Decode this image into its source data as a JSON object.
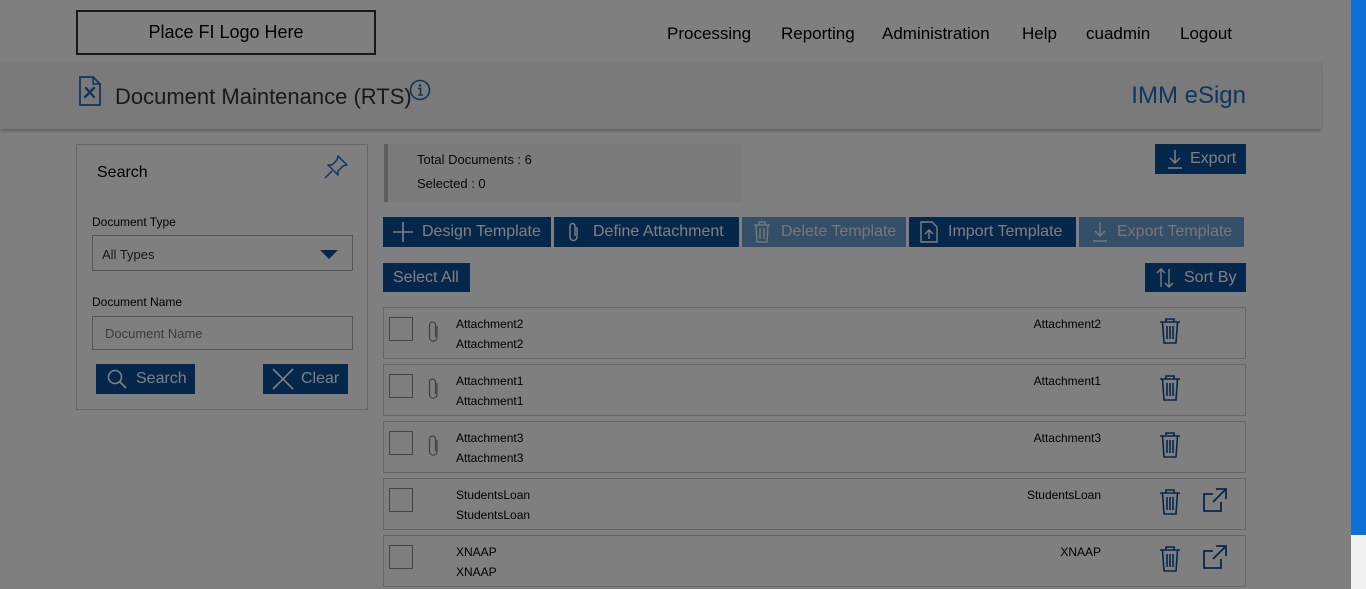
{
  "nav": {
    "logo_text": "Place FI Logo Here",
    "items": [
      "Processing",
      "Reporting",
      "Administration",
      "Help",
      "cuadmin",
      "Logout"
    ]
  },
  "header": {
    "title": "Document Maintenance (RTS)",
    "brand": "IMM eSign"
  },
  "search": {
    "heading": "Search",
    "doc_type_label": "Document Type",
    "doc_type_value": "All Types",
    "doc_name_label": "Document Name",
    "doc_name_placeholder": "Document Name",
    "search_button": "Search",
    "clear_button": "Clear"
  },
  "summary": {
    "total_documents": "Total Documents : 6",
    "selected": "Selected : 0"
  },
  "toolbar": {
    "export": "Export",
    "design_template": "Design Template",
    "define_attachment": "Define Attachment",
    "delete_template": "Delete Template",
    "import_template": "Import Template",
    "export_template": "Export Template",
    "select_all": "Select All",
    "sort_by": "Sort By"
  },
  "documents": [
    {
      "name": "Attachment2",
      "subname": "Attachment2",
      "right_label": "Attachment2",
      "attachment": true,
      "external": false
    },
    {
      "name": "Attachment1",
      "subname": "Attachment1",
      "right_label": "Attachment1",
      "attachment": true,
      "external": false
    },
    {
      "name": "Attachment3",
      "subname": "Attachment3",
      "right_label": "Attachment3",
      "attachment": true,
      "external": false
    },
    {
      "name": "StudentsLoan",
      "subname": "StudentsLoan",
      "right_label": "StudentsLoan",
      "attachment": false,
      "external": true
    },
    {
      "name": "XNAAP",
      "subname": "XNAAP",
      "right_label": "XNAAP",
      "attachment": false,
      "external": true
    }
  ],
  "colors": {
    "primary": "#0d4f99",
    "brand": "#1a6cc0",
    "disabled": "#6c9fd1",
    "scrollbar": "#0e6fd6"
  }
}
